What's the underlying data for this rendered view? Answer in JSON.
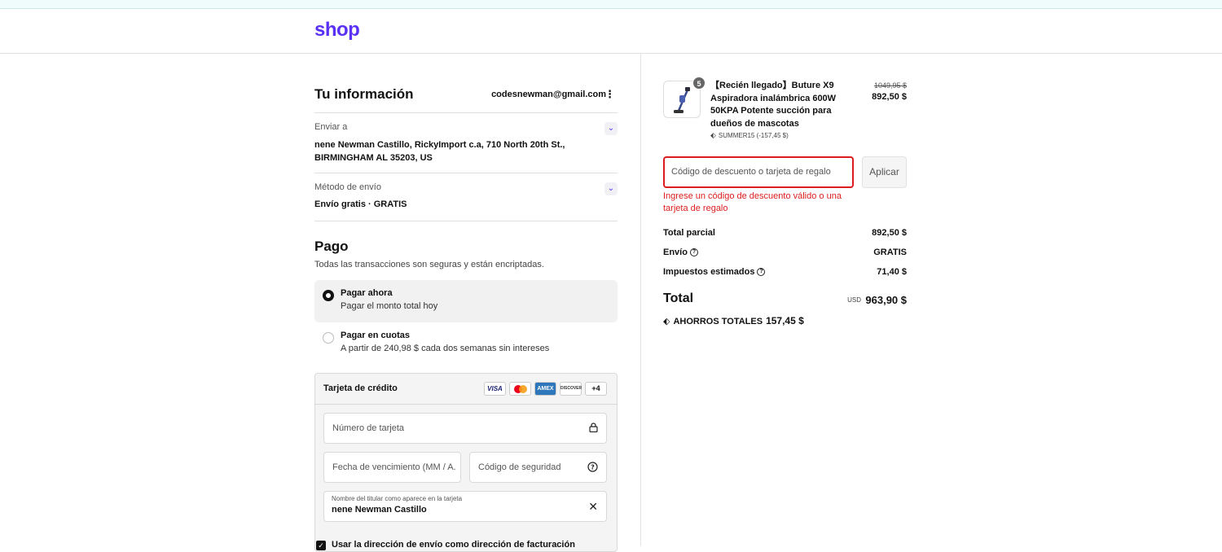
{
  "brand": {
    "logo": "shop",
    "accent_color": "#5a31f4"
  },
  "info": {
    "title": "Tu información",
    "email": "codesnewman@gmail.com",
    "ship_to_label": "Enviar a",
    "ship_to_value": "nene Newman Castillo, RickyImport c.a, 710 North 20th St., BIRMINGHAM AL 35203, US",
    "method_label": "Método de envío",
    "method_value": "Envío gratis · GRATIS"
  },
  "payment": {
    "title": "Pago",
    "subtitle": "Todas las transacciones son seguras y están encriptadas.",
    "options": [
      {
        "title": "Pagar ahora",
        "subtitle": "Pagar el monto total hoy",
        "selected": true
      },
      {
        "title": "Pagar en cuotas",
        "subtitle": "A partir de 240,98 $ cada dos semanas sin intereses",
        "selected": false
      }
    ],
    "card": {
      "title": "Tarjeta de crédito",
      "brands": {
        "visa": "VISA",
        "amex": "AMEX",
        "discover": "DISCOVER",
        "more": "+4"
      },
      "number_placeholder": "Número de tarjeta",
      "expiry_placeholder": "Fecha de vencimiento (MM / A...",
      "cvv_placeholder": "Código de seguridad",
      "name_label": "Nombre del titular como aparece en la tarjeta",
      "name_value": "nene Newman Castillo"
    },
    "billing_same_label": "Usar la dirección de envío como dirección de facturación"
  },
  "summary": {
    "product": {
      "quantity": "5",
      "name": "【Recién llegado】Buture X9 Aspiradora inalámbrica 600W 50KPA Potente succión para dueños de mascotas",
      "discount_code": "SUMMER15 (-157,45 $)",
      "old_price": "1049,95 $",
      "price": "892,50 $"
    },
    "discount_placeholder": "Código de descuento o tarjeta de regalo",
    "apply_label": "Aplicar",
    "error": "Ingrese un código de descuento válido o una tarjeta de regalo",
    "subtotal_label": "Total parcial",
    "subtotal_value": "892,50 $",
    "shipping_label": "Envío",
    "shipping_value": "GRATIS",
    "tax_label": "Impuestos estimados",
    "tax_value": "71,40 $",
    "total_label": "Total",
    "currency": "USD",
    "total_value": "963,90 $",
    "savings_label": "AHORROS TOTALES",
    "savings_value": "157,45 $",
    "error_color": "#dd1d1d"
  }
}
